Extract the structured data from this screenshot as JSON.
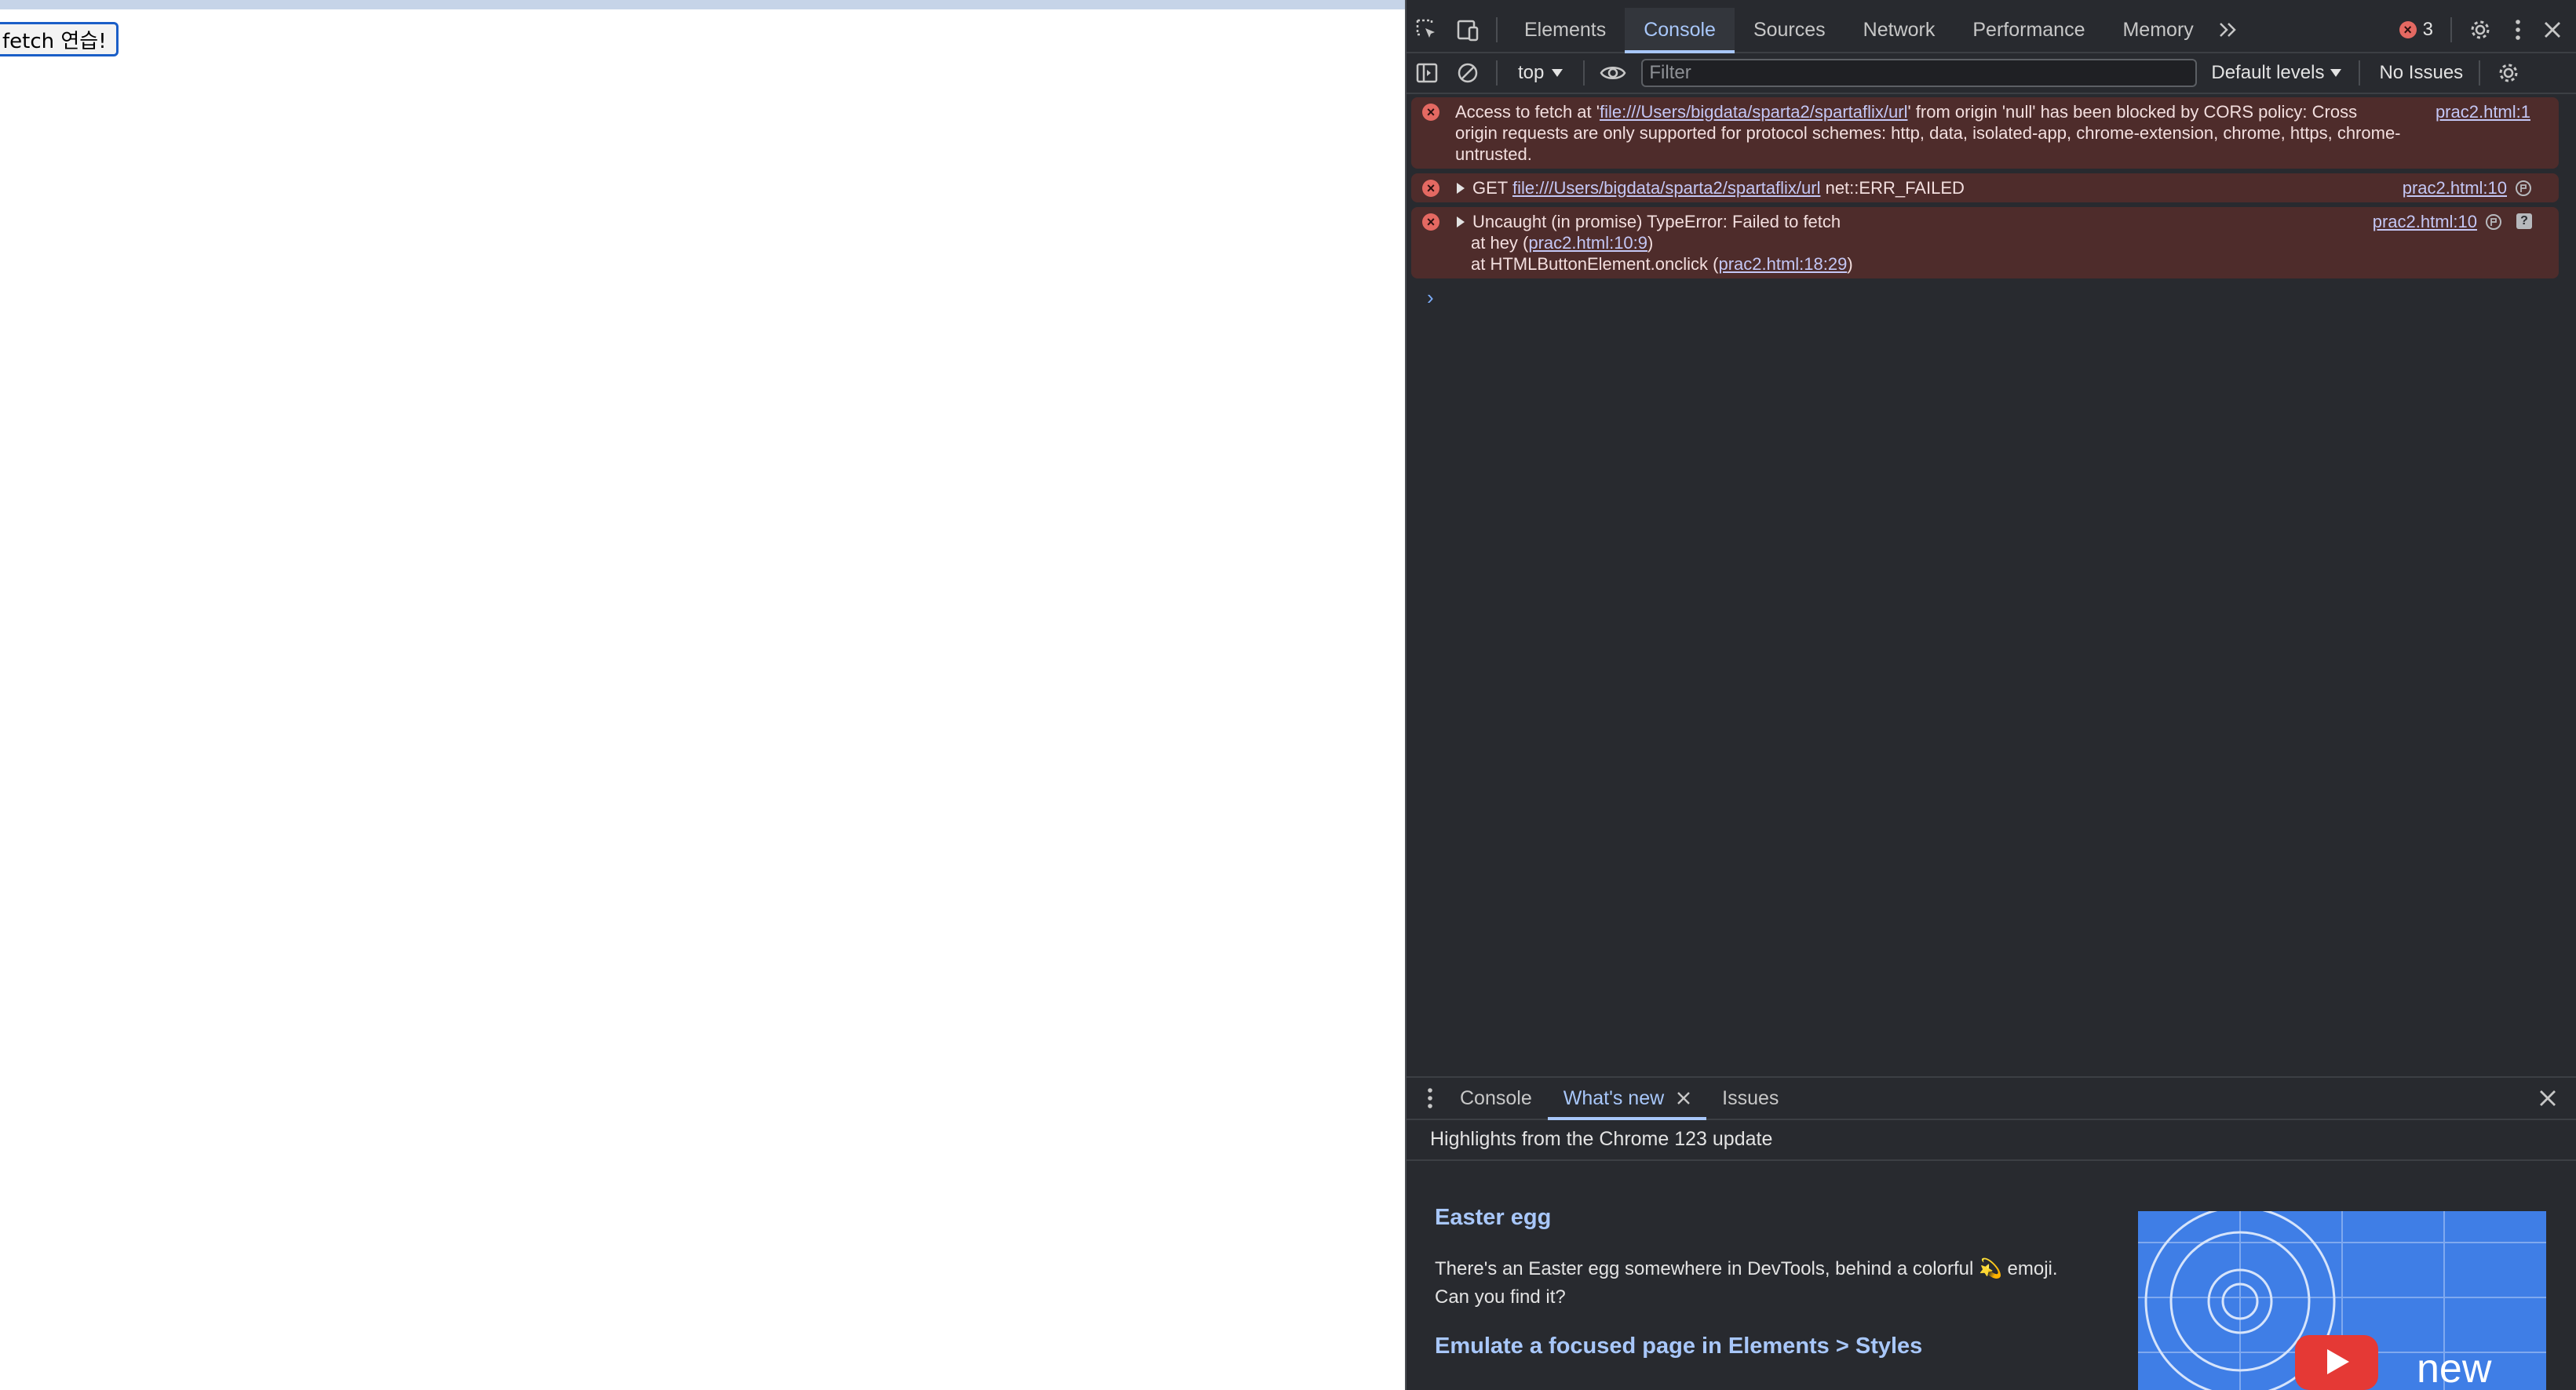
{
  "page": {
    "button_label": "fetch 연습!"
  },
  "devtools": {
    "tabs": [
      {
        "label": "Elements"
      },
      {
        "label": "Console"
      },
      {
        "label": "Sources"
      },
      {
        "label": "Network"
      },
      {
        "label": "Performance"
      },
      {
        "label": "Memory"
      }
    ],
    "error_count": "3",
    "console_toolbar": {
      "context": "top",
      "filter_placeholder": "Filter",
      "levels": "Default levels",
      "issues": "No Issues"
    },
    "messages": [
      {
        "prefix": "Access to fetch at '",
        "link": "file:///Users/bigdata/sparta2/spartaflix/url",
        "suffix": "' from origin 'null' has been blocked by CORS policy: Cross origin requests are only supported for protocol schemes: http, data, isolated-app, chrome-extension, chrome, https, chrome-untrusted.",
        "source": "prac2.html:1"
      },
      {
        "prefix": "GET ",
        "link": "file:///Users/bigdata/sparta2/spartaflix/url",
        "suffix": " net::ERR_FAILED",
        "source": "prac2.html:10"
      },
      {
        "line1": "Uncaught (in promise) TypeError: Failed to fetch",
        "line2_prefix": "at hey (",
        "line2_link": "prac2.html:10:9",
        "line2_suffix": ")",
        "line3_prefix": "at HTMLButtonElement.onclick (",
        "line3_link": "prac2.html:18:29",
        "line3_suffix": ")",
        "source": "prac2.html:10"
      }
    ],
    "drawer": {
      "tabs": [
        "Console",
        "What's new",
        "Issues"
      ],
      "highlights": "Highlights from the Chrome 123 update",
      "whats_new_title": "Easter egg",
      "whats_new_desc": "There's an Easter egg somewhere in DevTools, behind a colorful 💫 emoji. Can you find it?",
      "whats_new_link": "Emulate a focused page in Elements > Styles",
      "image_label": "new"
    }
  },
  "colors": {
    "accent": "#a8c7fa",
    "error": "#e46962",
    "error_bg": "#4e2c2b",
    "panel_bg": "#282a2f"
  }
}
